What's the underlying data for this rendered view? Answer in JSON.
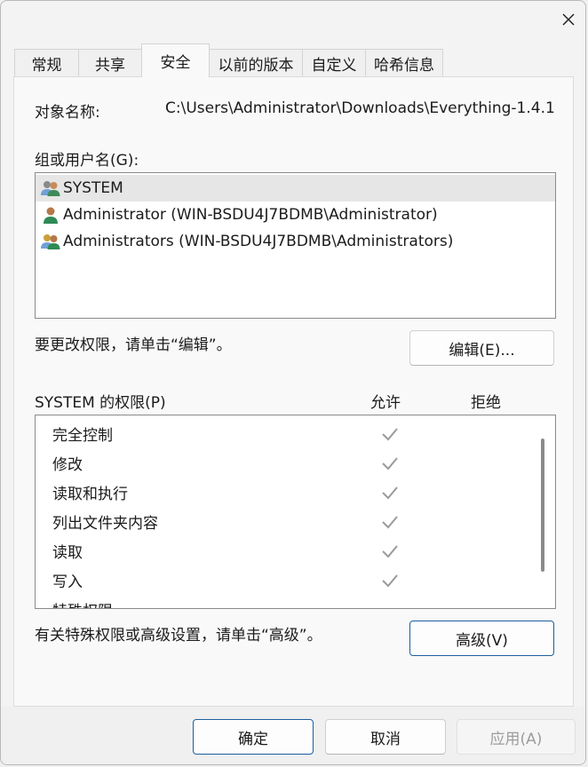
{
  "window": {
    "close_label": "×"
  },
  "tabs": [
    {
      "label": "常规",
      "active": false
    },
    {
      "label": "共享",
      "active": false
    },
    {
      "label": "安全",
      "active": true
    },
    {
      "label": "以前的版本",
      "active": false
    },
    {
      "label": "自定义",
      "active": false
    },
    {
      "label": "哈希信息",
      "active": false
    }
  ],
  "object": {
    "label": "对象名称:",
    "value": "C:\\Users\\Administrator\\Downloads\\Everything-1.4.1"
  },
  "groups": {
    "label": "组或用户名(G):",
    "items": [
      {
        "name": "SYSTEM",
        "icon": "group-users-icon",
        "selected": true
      },
      {
        "name": "Administrator (WIN-BSDU4J7BDMB\\Administrator)",
        "icon": "user-icon",
        "selected": false
      },
      {
        "name": "Administrators (WIN-BSDU4J7BDMB\\Administrators)",
        "icon": "group-users-icon",
        "selected": false
      }
    ]
  },
  "edit": {
    "hint": "要更改权限，请单击“编辑”。",
    "button_label": "编辑(E)..."
  },
  "permissions": {
    "title": "SYSTEM 的权限(P)",
    "allow_header": "允许",
    "deny_header": "拒绝",
    "items": [
      {
        "label": "完全控制",
        "allow": true,
        "deny": false
      },
      {
        "label": "修改",
        "allow": true,
        "deny": false
      },
      {
        "label": "读取和执行",
        "allow": true,
        "deny": false
      },
      {
        "label": "列出文件夹内容",
        "allow": true,
        "deny": false
      },
      {
        "label": "读取",
        "allow": true,
        "deny": false
      },
      {
        "label": "写入",
        "allow": true,
        "deny": false
      },
      {
        "label": "特殊权限",
        "allow": false,
        "deny": false
      }
    ]
  },
  "advanced": {
    "hint": "有关特殊权限或高级设置，请单击“高级”。",
    "button_label": "高级(V)"
  },
  "footer": {
    "ok_label": "确定",
    "cancel_label": "取消",
    "apply_label": "应用(A)"
  },
  "colors": {
    "check_gray": "#9a9a9a",
    "primary_border": "#1d5f9f"
  }
}
